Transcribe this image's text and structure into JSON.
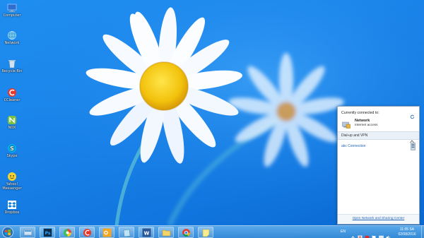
{
  "desktop": {
    "icons": [
      {
        "label": "Computer",
        "icon": "computer-icon"
      },
      {
        "label": "Network",
        "icon": "network-icon"
      },
      {
        "label": "Recycle Bin",
        "icon": "recycle-bin-icon"
      },
      {
        "label": "CCleaner",
        "icon": "ccleaner-icon"
      },
      {
        "label": "NOX",
        "icon": "nox-icon"
      },
      {
        "label": "Skype",
        "icon": "skype-icon"
      },
      {
        "label": "Yahoo! Messenger",
        "icon": "yahoo-messenger-icon"
      },
      {
        "label": "Dropbox",
        "icon": "dropbox-icon"
      }
    ]
  },
  "network_flyout": {
    "header": "Currently connected to:",
    "network_name": "Network",
    "network_status": "Internet access",
    "section_label": "Dial-up and VPN",
    "connection_label": "akc Connection",
    "footer_link": "Open Network and Sharing Center"
  },
  "taskbar": {
    "pinned": [
      "explorer-icon",
      "photoshop-icon",
      "chrome-color-icon",
      "ccleaner-icon",
      "outlook-icon",
      "app-icon",
      "word-icon",
      "folder-icon",
      "chrome-icon",
      "notes-icon"
    ],
    "language": "EN",
    "clock_time": "11:05 SA",
    "clock_date": "02/08/2016"
  },
  "colors": {
    "wallpaper": "#1a84ea",
    "flyout_link": "#2265b4",
    "taskbar": "#3c8cd7"
  }
}
